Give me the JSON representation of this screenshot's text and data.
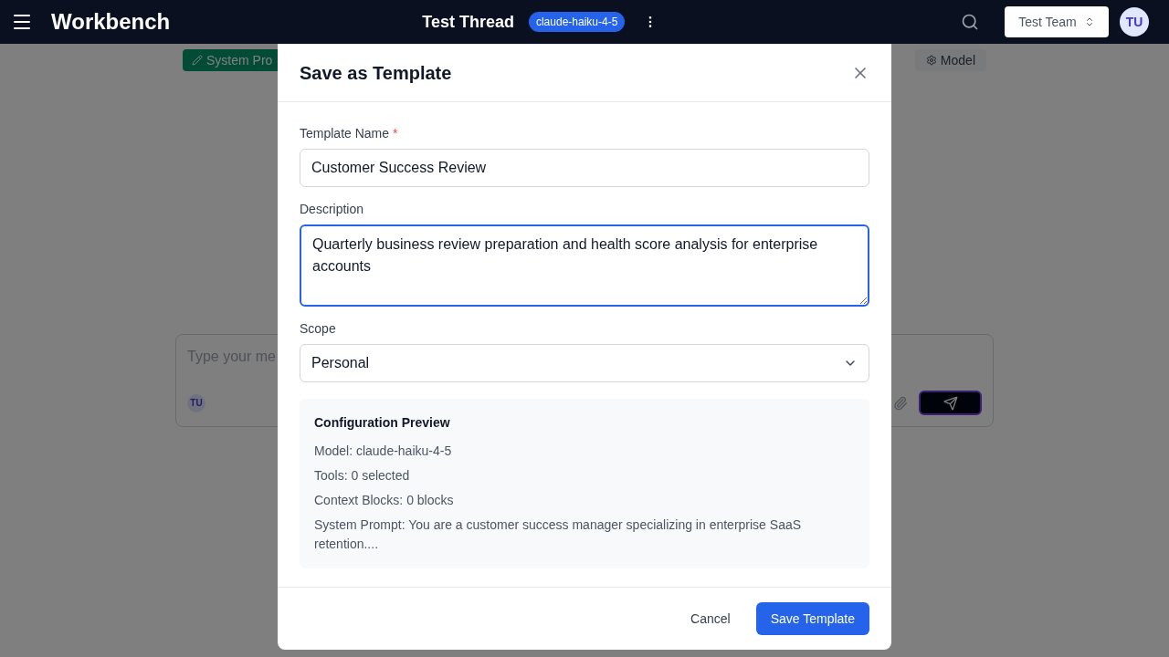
{
  "header": {
    "app_title": "Workbench",
    "thread_title": "Test Thread",
    "model_badge": "claude-haiku-4-5",
    "team_selector": "Test Team",
    "avatar": "TU"
  },
  "background": {
    "system_prompt_button": "System Pro",
    "model_button": "Model",
    "composer": {
      "placeholder": "Type your me",
      "avatar": "TU"
    }
  },
  "dialog": {
    "title": "Save as Template",
    "fields": [
      {
        "kind": "input",
        "label": "Template Name",
        "required_mark": "*",
        "value": "Customer Success Review",
        "focused": false
      },
      {
        "kind": "textarea",
        "label": "Description",
        "value": "Quarterly business review preparation and health score analysis for enterprise accounts",
        "focused": true
      },
      {
        "kind": "select",
        "label": "Scope",
        "value": "Personal",
        "focused": false
      }
    ],
    "preview": {
      "title": "Configuration Preview",
      "lines": [
        "Model: claude-haiku-4-5",
        "Tools: 0 selected",
        "Context Blocks: 0 blocks",
        "System Prompt: You are a customer success manager specializing in enterprise SaaS retention...."
      ]
    },
    "buttons": [
      {
        "label": "Cancel",
        "kind": "secondary"
      },
      {
        "label": "Save Template",
        "kind": "primary"
      }
    ]
  }
}
